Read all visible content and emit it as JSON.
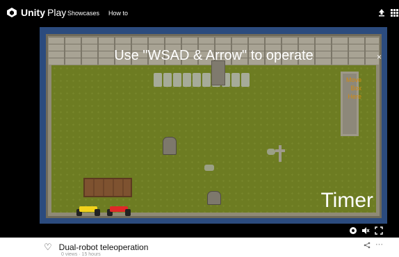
{
  "header": {
    "brand": "Unity",
    "brand_suffix": "Play",
    "nav": [
      "Showcases",
      "How to"
    ],
    "icons": [
      "upload-icon",
      "grid-menu-icon"
    ]
  },
  "game": {
    "instruction": "Use \"WSAD & Arrow\" to operate",
    "box_target_label": [
      "Move",
      "Box",
      "Here"
    ],
    "timer_label": "Timer",
    "robots": [
      {
        "color": "#f2d21b"
      },
      {
        "color": "#e02828"
      }
    ],
    "close_symbol": "×"
  },
  "controls": {
    "icons": [
      "settings-icon",
      "mute-icon",
      "fullscreen-icon"
    ]
  },
  "project": {
    "title": "Dual-robot teleoperation",
    "meta": "0 views · 15 hours",
    "like_icon": "heart-outline-icon",
    "share_icon": "share-icon",
    "more_symbol": "···"
  },
  "colors": {
    "topbar": "#000000",
    "frame": "#2b4b7e",
    "grass": "#6d7c22",
    "box_label": "#d38b10"
  }
}
